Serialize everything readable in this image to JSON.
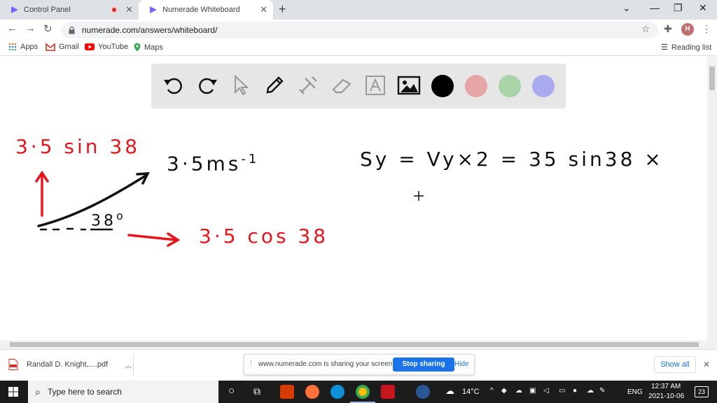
{
  "browser": {
    "tabs": [
      {
        "title": "Control Panel",
        "recording": true
      },
      {
        "title": "Numerade Whiteboard",
        "active": true
      }
    ],
    "url": "numerade.com/answers/whiteboard/",
    "profile_initial": "H",
    "bookmarks": [
      "Apps",
      "Gmail",
      "YouTube",
      "Maps"
    ],
    "reading_list": "Reading list"
  },
  "whiteboard": {
    "swatches": [
      "#000000",
      "#e6a6a6",
      "#a8d4a8",
      "#aaaaee"
    ],
    "ink": {
      "top_left": "3·5 sin 38",
      "velocity": "3·5ms",
      "velocity_sup": "-1",
      "angle": "38",
      "angle_deg": "o",
      "bottom": "3·5 cos 38",
      "equation": "Sy = Vy×2 = 35 sin38 ×"
    }
  },
  "downloads": {
    "file": "Randall D. Knight,....pdf",
    "show_all": "Show all"
  },
  "sharing": {
    "message": "www.numerade.com is sharing your screen.",
    "stop": "Stop sharing",
    "hide": "Hide"
  },
  "taskbar": {
    "search_placeholder": "Type here to search",
    "weather": "14°C",
    "lang": "ENG",
    "time": "12:37 AM",
    "date": "2021-10-06",
    "notifications": "23"
  },
  "colors": {
    "ink_red": "#e8141c",
    "ink_black": "#111111",
    "accent": "#1a73e8"
  }
}
